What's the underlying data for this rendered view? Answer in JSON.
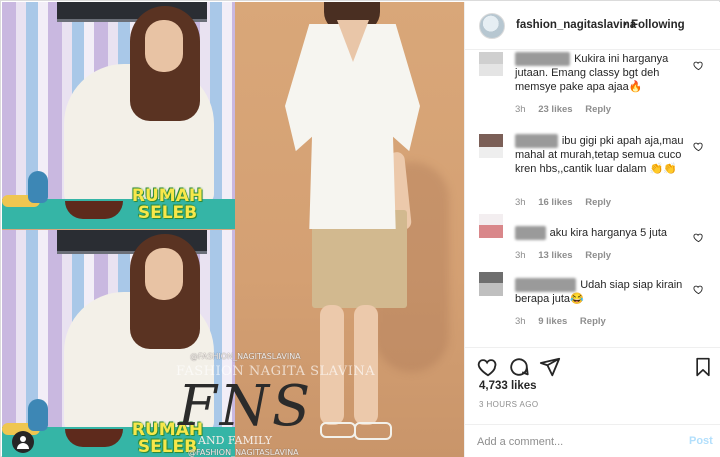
{
  "post": {
    "username": "fashion_nagitaslavina",
    "separator": "•",
    "follow_status": "Following",
    "likes": "4,733 likes",
    "time_ago": "3 HOURS AGO"
  },
  "comments": [
    {
      "text": "Kukira ini harganya jutaan. Emang classy bgt deh memsye pake apa ajaa🔥",
      "time": "3h",
      "likes": "23 likes",
      "reply": "Reply"
    },
    {
      "text": "ibu gigi pki apah aja,mau mahal at murah,tetap semua cuco kren hbs,,cantik luar dalam 👏👏",
      "time": "3h",
      "likes": "16 likes",
      "reply": "Reply"
    },
    {
      "text": "aku kira harganya 5 juta",
      "time": "3h",
      "likes": "13 likes",
      "reply": "Reply"
    },
    {
      "text": "Udah siap siap kirain berapa juta😂",
      "time": "3h",
      "likes": "9 likes",
      "reply": "Reply"
    }
  ],
  "composer": {
    "placeholder": "Add a comment...",
    "post_label": "Post"
  },
  "watermark": {
    "handle_top": "@FASHION_NAGITASLAVINA",
    "subtitle": "FASHION NAGITA SLAVINA",
    "logo": "FNS",
    "family": "AND FAMILY",
    "handle_bottom": "@FASHION_NAGITASLAVINA",
    "show_logo": "RUMAH SELEB"
  },
  "icons": [
    "heart-icon",
    "comment-icon",
    "share-icon",
    "bookmark-icon",
    "user-tag-icon"
  ],
  "colors": {
    "accent": "#0095f6",
    "post_disabled": "#b2dffc",
    "meta": "#8e8e8e"
  }
}
